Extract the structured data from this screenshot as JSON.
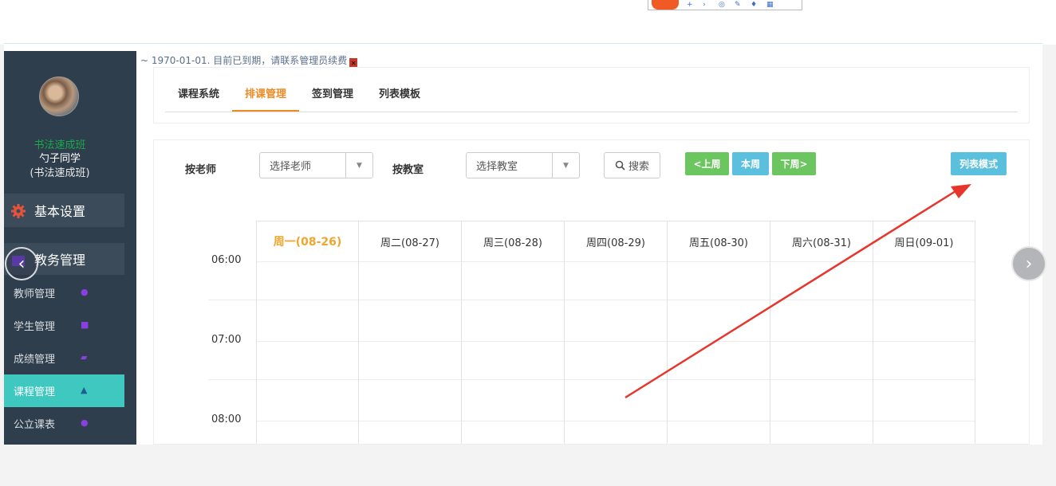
{
  "notice": "~ 1970-01-01. 目前已到期，请联系管理员续费",
  "sidebar": {
    "school": "书法速成班",
    "user_name": "勺子同学",
    "user_class": "(书法速成班)",
    "section1": "基本设置",
    "section2": "教务管理",
    "items": [
      {
        "label": "教师管理",
        "icon": "user-icon"
      },
      {
        "label": "学生管理",
        "icon": "users-icon"
      },
      {
        "label": "成绩管理",
        "icon": "book-icon"
      },
      {
        "label": "课程管理",
        "icon": "graduation-cap-icon",
        "active": true
      },
      {
        "label": "公立课表",
        "icon": "apple-icon"
      }
    ]
  },
  "tabs": [
    {
      "label": "课程系统",
      "active": false
    },
    {
      "label": "排课管理",
      "active": true
    },
    {
      "label": "签到管理",
      "active": false
    },
    {
      "label": "列表模板",
      "active": false
    }
  ],
  "filters": {
    "teacher_label": "按老师",
    "teacher_select": "选择老师",
    "room_label": "按教室",
    "room_select": "选择教室",
    "search": "搜索",
    "prev_week": "<上周",
    "this_week": "本周",
    "next_week": "下周>",
    "list_mode": "列表模式"
  },
  "calendar": {
    "days": [
      "周一(08-26)",
      "周二(08-27)",
      "周三(08-28)",
      "周四(08-29)",
      "周五(08-30)",
      "周六(08-31)",
      "周日(09-01)"
    ],
    "times": [
      "06:00",
      "07:00",
      "08:00"
    ]
  },
  "colors": {
    "accent_orange": "#f08a24",
    "green_button": "#6cc65f",
    "blue_button": "#5bc0de",
    "active_menu": "#3ec8c0",
    "annotation_arrow": "#e8352b"
  }
}
